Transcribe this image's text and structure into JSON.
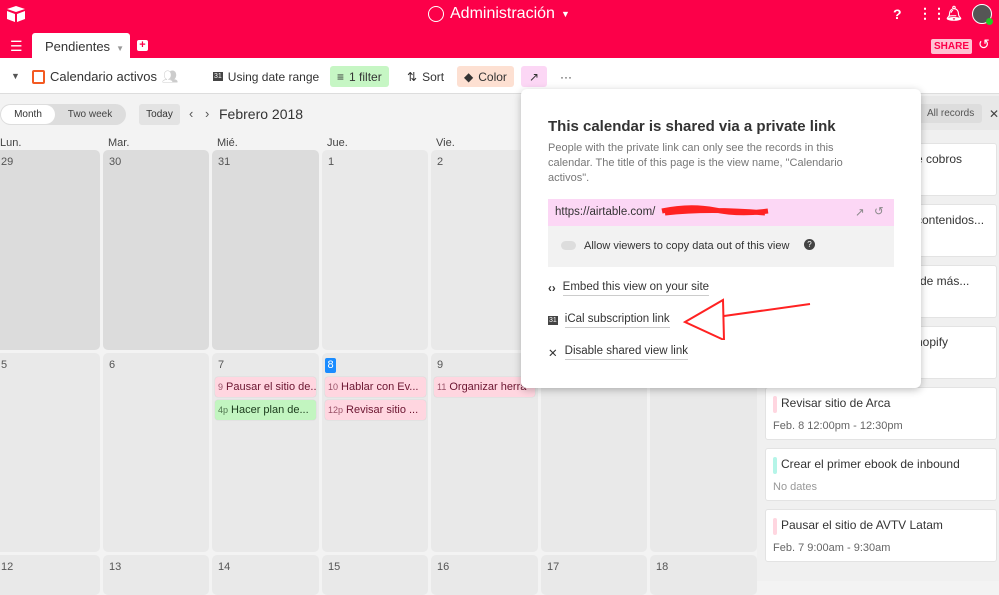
{
  "header": {
    "base_name": "Administración",
    "share_label": "SHARE",
    "accent": "#fc0049"
  },
  "tabs": [
    {
      "label": "Pendientes"
    }
  ],
  "toolbar": {
    "view_name": "Calendario activos",
    "date_range": "Using date range",
    "filter": "1 filter",
    "sort": "Sort",
    "color": "Color",
    "more": "···"
  },
  "calendar": {
    "modes": [
      "Month",
      "Two week"
    ],
    "active_mode": "Month",
    "today_label": "Today",
    "month_label": "Febrero 2018",
    "day_headers": [
      "Lun.",
      "Mar.",
      "Mié.",
      "Jue.",
      "Vie.",
      "",
      ""
    ],
    "weeks": [
      {
        "days": [
          {
            "n": "29",
            "prev": true
          },
          {
            "n": "30",
            "prev": true
          },
          {
            "n": "31",
            "prev": true
          },
          {
            "n": "1"
          },
          {
            "n": "2"
          },
          {
            "n": ""
          },
          {
            "n": ""
          }
        ]
      },
      {
        "days": [
          {
            "n": "5"
          },
          {
            "n": "6"
          },
          {
            "n": "7",
            "events": [
              {
                "time": "9",
                "title": "Pausar el sitio de...",
                "color": "#ffd6e0"
              },
              {
                "time": "4p",
                "title": "Hacer plan de...",
                "color": "#c2f5c0"
              }
            ]
          },
          {
            "n": "8",
            "today": true,
            "events": [
              {
                "time": "10",
                "title": "Hablar con Ev...",
                "color": "#ffd6e0"
              },
              {
                "time": "12p",
                "title": "Revisar sitio ...",
                "color": "#ffd6e0"
              }
            ]
          },
          {
            "n": "9",
            "events": [
              {
                "time": "11",
                "title": "Organizar herra",
                "color": "#ffd6e0"
              }
            ]
          },
          {
            "n": ""
          },
          {
            "n": ""
          }
        ]
      },
      {
        "days": [
          {
            "n": "12"
          },
          {
            "n": "13"
          },
          {
            "n": "14"
          },
          {
            "n": "15"
          },
          {
            "n": "16"
          },
          {
            "n": "17"
          },
          {
            "n": "18"
          }
        ]
      }
    ]
  },
  "sidebar": {
    "filter_label": "All records",
    "cards": [
      {
        "title": "e cobros",
        "sub": "",
        "color": ""
      },
      {
        "title": "contenidos...",
        "sub": "",
        "color": ""
      },
      {
        "title": "r lo de más...",
        "sub": "",
        "color": ""
      },
      {
        "title": "hopify",
        "sub": "",
        "color": ""
      },
      {
        "title": "Revisar sitio de Arca",
        "sub": "Feb. 8 12:00pm - 12:30pm",
        "color": "#ffd6e0"
      },
      {
        "title": "Crear el primer ebook de inbound",
        "sub": "No dates",
        "color": "#b5f5e8"
      },
      {
        "title": "Pausar el sitio de AVTV Latam",
        "sub": "Feb. 7 9:00am - 9:30am",
        "color": "#ffd6e0"
      }
    ]
  },
  "share_popover": {
    "title": "This calendar is shared via a private link",
    "description": "People with the private link can only see the records in this calendar. The title of this page is the view name, \"Calendario activos\".",
    "link": "https://airtable.com/",
    "allow_copy": "Allow viewers to copy data out of this view",
    "allow_copy_enabled": false,
    "embed": "Embed this view on your site",
    "ical": "iCal subscription link",
    "disable": "Disable shared view link"
  }
}
